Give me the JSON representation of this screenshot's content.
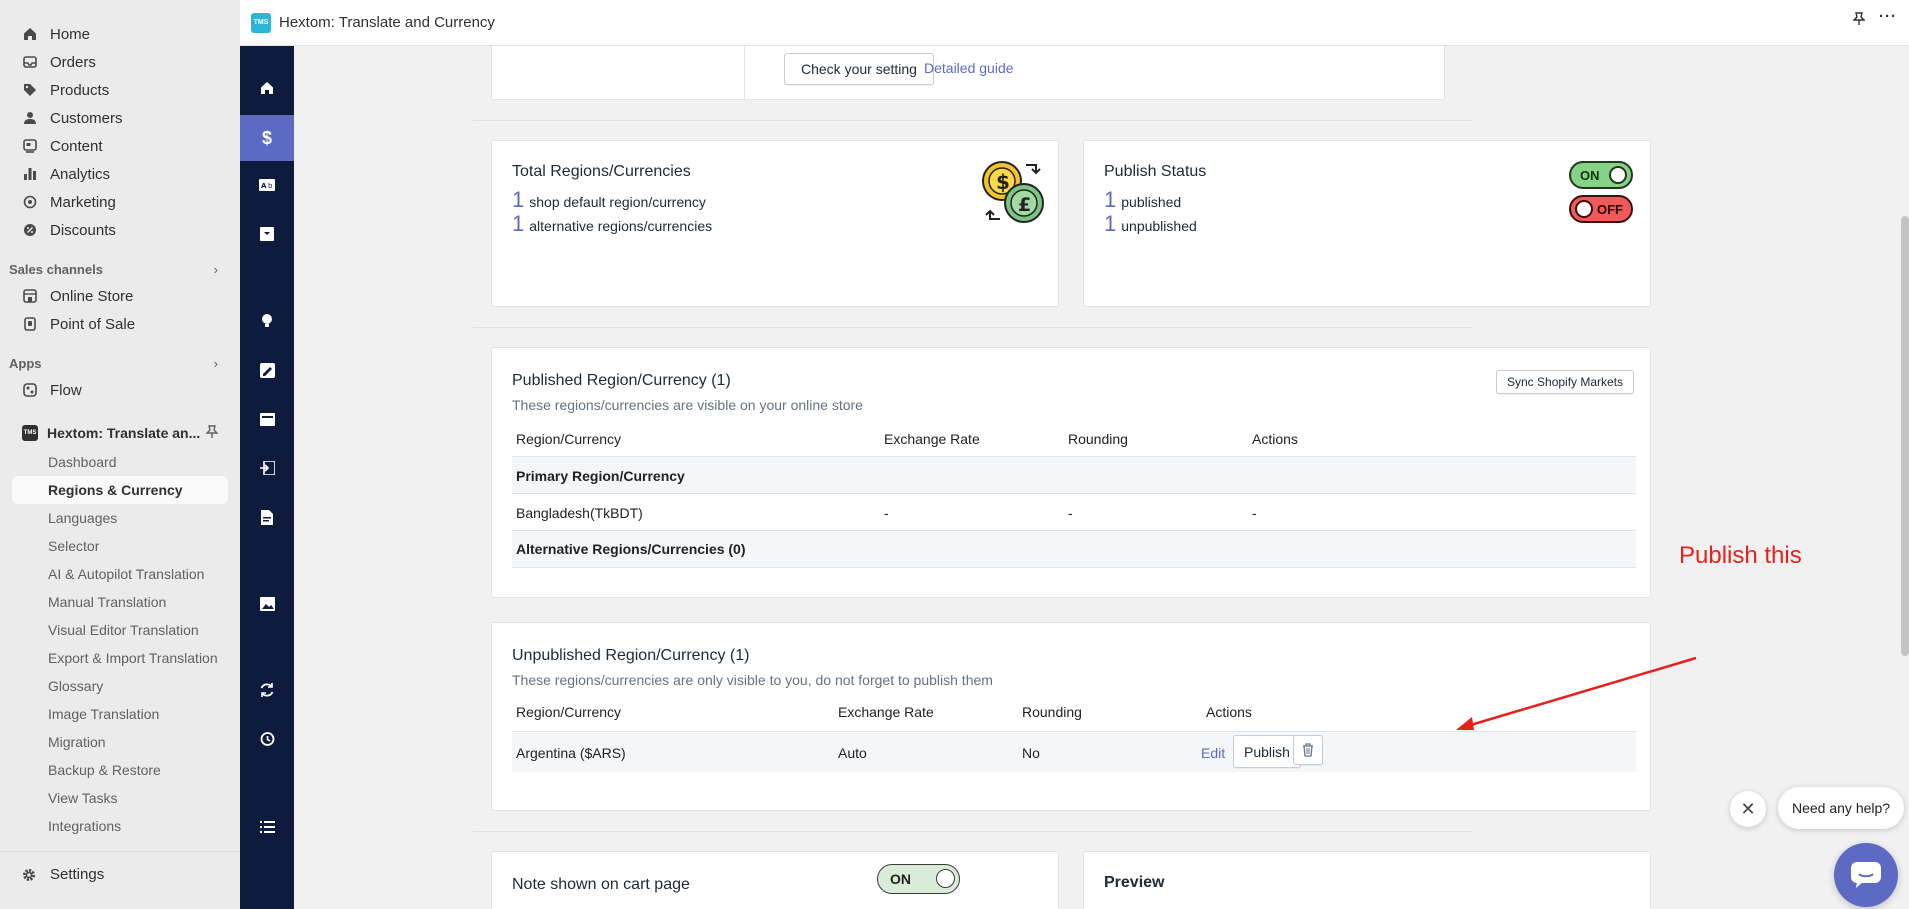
{
  "sidebar": {
    "main_items": [
      {
        "label": "Home",
        "icon": "home-icon"
      },
      {
        "label": "Orders",
        "icon": "orders-icon"
      },
      {
        "label": "Products",
        "icon": "tag-icon"
      },
      {
        "label": "Customers",
        "icon": "person-icon"
      },
      {
        "label": "Content",
        "icon": "content-icon"
      },
      {
        "label": "Analytics",
        "icon": "bar-chart-icon"
      },
      {
        "label": "Marketing",
        "icon": "target-icon"
      },
      {
        "label": "Discounts",
        "icon": "discount-icon"
      }
    ],
    "sales_channels_label": "Sales channels",
    "sales_channels": [
      {
        "label": "Online Store"
      },
      {
        "label": "Point of Sale"
      }
    ],
    "apps_label": "Apps",
    "apps": [
      {
        "label": "Flow"
      }
    ],
    "app_name": "Hextom: Translate an...",
    "app_badge": "TMS",
    "app_sub_items": [
      "Dashboard",
      "Regions & Currency",
      "Languages",
      "Selector",
      "AI & Autopilot Translation",
      "Manual Translation",
      "Visual Editor Translation",
      "Export & Import Translation",
      "Glossary",
      "Image Translation",
      "Migration",
      "Backup & Restore",
      "View Tasks",
      "Integrations"
    ],
    "settings_label": "Settings"
  },
  "topbar": {
    "badge": "TMS",
    "title": "Hextom: Translate and Currency",
    "pin_icon": "pin-icon",
    "more_icon": "more-horizontal-icon"
  },
  "top_card": {
    "check_button": "Check your setting",
    "guide_link": "Detailed guide"
  },
  "totals": {
    "title": "Total Regions/Currencies",
    "default_count": "1",
    "default_text": "shop default region/currency",
    "alt_count": "1",
    "alt_text": "alternative regions/currencies"
  },
  "publish_status": {
    "title": "Publish Status",
    "published_count": "1",
    "published_text": "published",
    "unpublished_count": "1",
    "unpublished_text": "unpublished",
    "on_label": "ON",
    "off_label": "OFF"
  },
  "published": {
    "title": "Published Region/Currency (1)",
    "subtitle": "These regions/currencies are visible on your online store",
    "sync_button": "Sync Shopify Markets",
    "columns": [
      "Region/Currency",
      "Exchange Rate",
      "Rounding",
      "Actions"
    ],
    "primary_heading": "Primary Region/Currency",
    "primary_row": [
      "Bangladesh(TkBDT)",
      "-",
      "-",
      "-"
    ],
    "alternative_heading": "Alternative Regions/Currencies (0)"
  },
  "unpublished": {
    "title": "Unpublished Region/Currency (1)",
    "subtitle": "These regions/currencies are only visible to you, do not forget to publish them",
    "columns": [
      "Region/Currency",
      "Exchange Rate",
      "Rounding",
      "Actions"
    ],
    "row": [
      "Argentina ($ARS)",
      "Auto",
      "No"
    ],
    "edit_link": "Edit",
    "publish_button": "Publish"
  },
  "annotation": {
    "text": "Publish this",
    "color": "#e8201c"
  },
  "note_card": {
    "title": "Note shown on cart page",
    "toggle_label": "ON"
  },
  "preview_card": {
    "title": "Preview"
  },
  "help_widget": {
    "bubble_text": "Need any help?"
  },
  "colors": {
    "rail": "#0f1b3d",
    "accent": "#5c6ac4",
    "on_toggle": "#86d286",
    "off_toggle": "#f05a5a"
  }
}
